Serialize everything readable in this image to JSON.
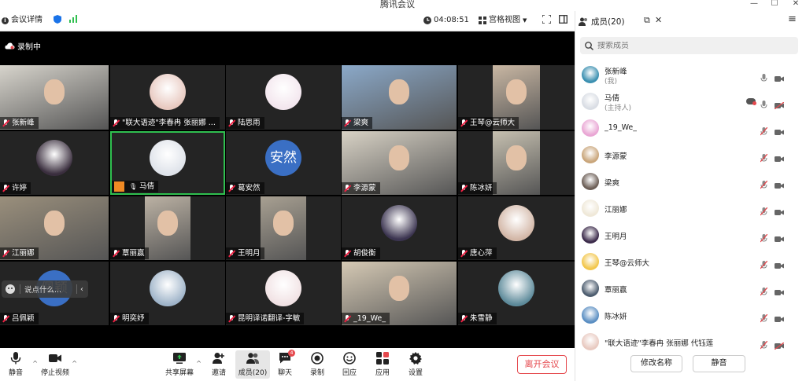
{
  "window": {
    "title": "腾讯会议"
  },
  "toolbar": {
    "meeting_info": "会议详情",
    "timer": "04:08:51",
    "view_mode": "宫格视图"
  },
  "recording": {
    "label": "录制中"
  },
  "tiles": [
    {
      "name": "张新峰",
      "kind": "photo",
      "muted": true,
      "bg": "#d7d4cc"
    },
    {
      "name": "\"联大语迹\"李春冉 张丽娜 ...",
      "kind": "avatar",
      "muted": true,
      "bg": "#e8c9c0"
    },
    {
      "name": "陆思雨",
      "kind": "avatar",
      "muted": true,
      "bg": "#f3e6ee"
    },
    {
      "name": "梁爽",
      "kind": "photo",
      "muted": true,
      "bg": "#8ba9c9"
    },
    {
      "name": "王琴@云师大",
      "kind": "photo",
      "muted": true,
      "bg": "#c9b7a3"
    },
    {
      "name": "许婷",
      "kind": "avatar",
      "muted": true,
      "bg": "#3a2e3e"
    },
    {
      "name": "马倩",
      "kind": "avatar",
      "muted": false,
      "speaking": true,
      "bg": "#dfe3ea"
    },
    {
      "name": "葛安然",
      "kind": "text",
      "muted": true,
      "bigtext": "安然",
      "bg": "#3a6fc4"
    },
    {
      "name": "李源蒙",
      "kind": "photo",
      "muted": true,
      "bg": "#d8d2c5"
    },
    {
      "name": "陈冰妍",
      "kind": "photo",
      "muted": true,
      "bg": "#c6c0b0"
    },
    {
      "name": "江丽娜",
      "kind": "photo",
      "muted": true,
      "bg": "#9a8f7c"
    },
    {
      "name": "覃丽赢",
      "kind": "photo",
      "muted": true,
      "bg": "#bcb2a4"
    },
    {
      "name": "王明月",
      "kind": "photo",
      "muted": true,
      "bg": "#a8a092"
    },
    {
      "name": "胡俊衡",
      "kind": "avatar",
      "muted": true,
      "bg": "#3b3450"
    },
    {
      "name": "唐心萍",
      "kind": "avatar",
      "muted": true,
      "bg": "#d3b7a7"
    },
    {
      "name": "吕佩颖",
      "kind": "text",
      "muted": true,
      "bigtext": "佩颖",
      "bg": "#3a6fc4"
    },
    {
      "name": "明奕妤",
      "kind": "avatar",
      "muted": true,
      "bg": "#9fb4c9"
    },
    {
      "name": "昆明译诺翻译-字敏",
      "kind": "avatar",
      "muted": true,
      "bg": "#f1e2e4"
    },
    {
      "name": "_19_We_",
      "kind": "photo",
      "muted": true,
      "bg": "#d5c9b4"
    },
    {
      "name": "朱雪静",
      "kind": "avatar",
      "muted": true,
      "bg": "#5d8a9a"
    }
  ],
  "chat_input": {
    "placeholder": "说点什么..."
  },
  "controls": {
    "mute": "静音",
    "stop_video": "停止视频",
    "share": "共享屏幕",
    "invite": "邀请",
    "members": "成员(20)",
    "chat": "聊天",
    "chat_badge": "4",
    "record": "录制",
    "react": "回应",
    "apps": "应用",
    "settings": "设置",
    "leave": "离开会议"
  },
  "panel": {
    "title": "成员(20)",
    "search_placeholder": "搜索成员",
    "members": [
      {
        "name": "张新峰",
        "role": "(我)",
        "color": "#3a8fb0",
        "muted": false,
        "cam": "on"
      },
      {
        "name": "马倩",
        "role": "(主持人)",
        "color": "#d9dde4",
        "muted": false,
        "cam": "off",
        "rec": true
      },
      {
        "name": "_19_We_",
        "role": "",
        "color": "#e9a6d4",
        "muted": true,
        "cam": "on"
      },
      {
        "name": "李源蒙",
        "role": "",
        "color": "#c9a57a",
        "muted": true,
        "cam": "on"
      },
      {
        "name": "梁爽",
        "role": "",
        "color": "#6b5d55",
        "muted": true,
        "cam": "on"
      },
      {
        "name": "江丽娜",
        "role": "",
        "color": "#efe8d8",
        "muted": true,
        "cam": "on"
      },
      {
        "name": "王明月",
        "role": "",
        "color": "#3b2a4a",
        "muted": true,
        "cam": "on"
      },
      {
        "name": "王琴@云师大",
        "role": "",
        "color": "#f2c64b",
        "muted": true,
        "cam": "on"
      },
      {
        "name": "覃丽赢",
        "role": "",
        "color": "#4c5c6e",
        "muted": true,
        "cam": "on"
      },
      {
        "name": "陈冰妍",
        "role": "",
        "color": "#5a8ec2",
        "muted": true,
        "cam": "on"
      },
      {
        "name": "\"联大语迹\"李春冉 张丽娜 代钰莲",
        "role": "",
        "color": "#e8c9c0",
        "muted": true,
        "cam": "off"
      }
    ],
    "rename_button": "修改名称",
    "mute_button": "静音"
  }
}
